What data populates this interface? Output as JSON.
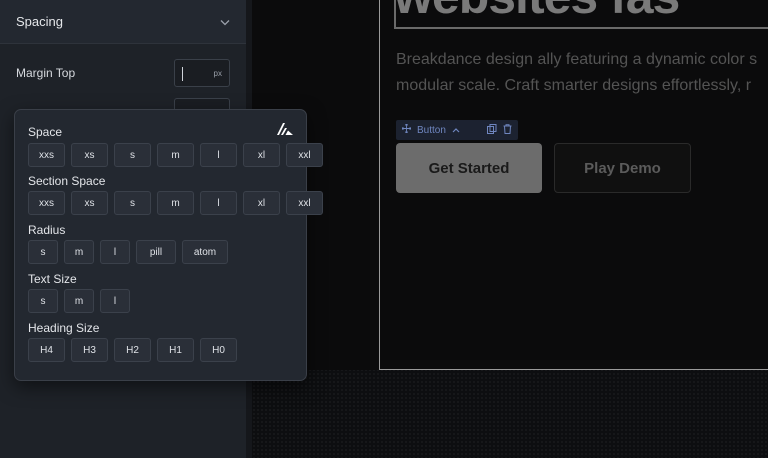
{
  "panel": {
    "section_title": "Spacing",
    "margin_top_label": "Margin Top",
    "margin_top_unit": "px"
  },
  "popover": {
    "groups": [
      {
        "label": "Space",
        "options": [
          "xxs",
          "xs",
          "s",
          "m",
          "l",
          "xl",
          "xxl"
        ]
      },
      {
        "label": "Section Space",
        "options": [
          "xxs",
          "xs",
          "s",
          "m",
          "l",
          "xl",
          "xxl"
        ]
      },
      {
        "label": "Radius",
        "options": [
          "s",
          "m",
          "l",
          "pill",
          "atom"
        ]
      },
      {
        "label": "Text Size",
        "options": [
          "s",
          "m",
          "l"
        ]
      },
      {
        "label": "Heading Size",
        "options": [
          "H4",
          "H3",
          "H2",
          "H1",
          "H0"
        ]
      }
    ]
  },
  "canvas": {
    "hero_heading": "websites fas",
    "hero_text_line1": "Breakdance design ally featuring a dynamic color s",
    "hero_text_line2": "modular scale. Craft smarter designs effortlessly, r",
    "element_label": "Button",
    "primary_button": "Get Started",
    "secondary_button": "Play Demo"
  },
  "icons": {
    "collapse": "chevron-down-icon",
    "logo": "breakdance-logo-icon",
    "move": "move-icon",
    "parent": "chevron-up-icon",
    "duplicate": "duplicate-icon",
    "delete": "trash-icon"
  },
  "colors": {
    "panel_bg": "#1e2228",
    "popover_bg": "#232830",
    "chip_bg": "#2a2f38",
    "element_label_text": "#6f86bf",
    "primary_button_bg": "#6c6c6c"
  }
}
